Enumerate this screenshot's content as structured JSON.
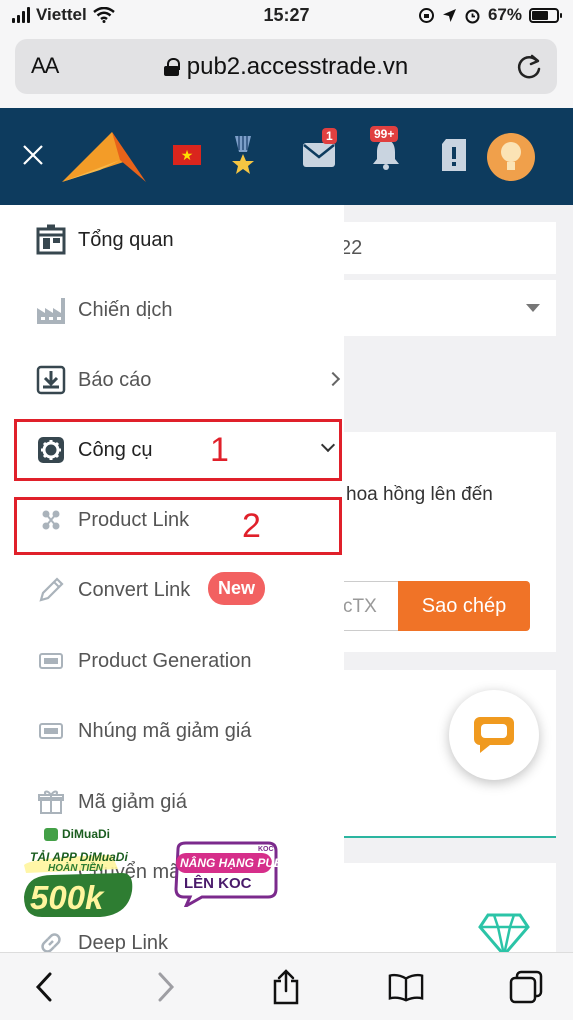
{
  "status_bar": {
    "carrier": "Viettel",
    "time": "15:27",
    "battery": "67%",
    "battery_level": 0.67
  },
  "browser": {
    "text_size_label": "AA",
    "url": "pub2.accesstrade.vn"
  },
  "header": {
    "mail_badge": "1",
    "bell_badge": "99+",
    "flag_star": "★"
  },
  "background": {
    "date_value": "22",
    "commission_text": "hoa hồng lên đến",
    "code_value": "cTX",
    "copy_button": "Sao chép"
  },
  "menu": {
    "items": [
      {
        "label": "Tổng quan",
        "icon": "dashboard-icon"
      },
      {
        "label": "Chiến dịch",
        "icon": "factory-icon"
      },
      {
        "label": "Báo cáo",
        "icon": "download-box-icon"
      },
      {
        "label": "Công cụ",
        "icon": "gear-icon"
      },
      {
        "label": "Product Link",
        "icon": "link-nodes-icon"
      },
      {
        "label": "Convert Link",
        "icon": "pencil-icon",
        "badge": "New"
      },
      {
        "label": "Product Generation",
        "icon": "ticket-icon"
      },
      {
        "label": "Nhúng mã giảm giá",
        "icon": "ticket-icon"
      },
      {
        "label": "Mã giảm giá",
        "icon": "gift-icon"
      },
      {
        "label": "Chuyển mã",
        "icon": "swap-icon"
      },
      {
        "label": "Deep Link",
        "icon": "chain-link-icon"
      }
    ]
  },
  "annotations": {
    "one": "1",
    "two": "2"
  },
  "promos": {
    "dimuadi_brand": "DiMuaDi",
    "dimuadi_line1": "TẢI APP DiMuaDi",
    "dimuadi_line2": "HOÀN TIỀN",
    "dimuadi_amount": "500k",
    "koc_line1": "NÂNG HẠNG PUB",
    "koc_line2": "LÊN KOC",
    "koc_tag": "KOC"
  },
  "colors": {
    "header_bg": "#0d3b5e",
    "accent_orange": "#f07327",
    "annotation_red": "#e0202a",
    "new_badge": "#f26161"
  }
}
